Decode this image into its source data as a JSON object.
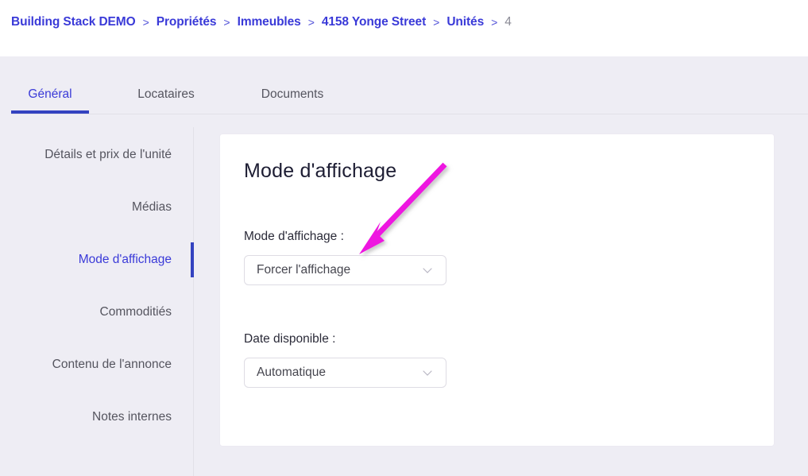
{
  "breadcrumb": {
    "separator": ">",
    "items": [
      {
        "label": "Building Stack DEMO",
        "current": false
      },
      {
        "label": "Propriétés",
        "current": false
      },
      {
        "label": "Immeubles",
        "current": false
      },
      {
        "label": "4158 Yonge Street",
        "current": false
      },
      {
        "label": "Unités",
        "current": false
      },
      {
        "label": "4",
        "current": true
      }
    ]
  },
  "tabs": [
    {
      "label": "Général",
      "active": true
    },
    {
      "label": "Locataires",
      "active": false
    },
    {
      "label": "Documents",
      "active": false
    }
  ],
  "sidebar": {
    "items": [
      {
        "label": "Détails et prix de l'unité",
        "active": false
      },
      {
        "label": "Médias",
        "active": false
      },
      {
        "label": "Mode d'affichage",
        "active": true
      },
      {
        "label": "Commoditiés",
        "active": false
      },
      {
        "label": "Contenu de l'annonce",
        "active": false
      },
      {
        "label": "Notes internes",
        "active": false
      }
    ]
  },
  "card": {
    "title": "Mode d'affichage",
    "fields": [
      {
        "label": "Mode d'affichage :",
        "value": "Forcer l'affichage",
        "icon": "chevron-down-icon"
      },
      {
        "label": "Date disponible :",
        "value": "Automatique",
        "icon": "chevron-down-icon"
      }
    ]
  },
  "annotation": {
    "type": "arrow",
    "color": "#ee18e0",
    "points_to": "mode-affichage-select"
  },
  "colors": {
    "page_background": "#eeedf4",
    "header_background": "#ffffff",
    "accent_blue": "#3342c0",
    "link_blue": "#3a3ad8",
    "text_gray": "#55555f",
    "card_background": "#ffffff",
    "border_gray": "#dedce4",
    "annotation_magenta": "#ee18e0"
  }
}
